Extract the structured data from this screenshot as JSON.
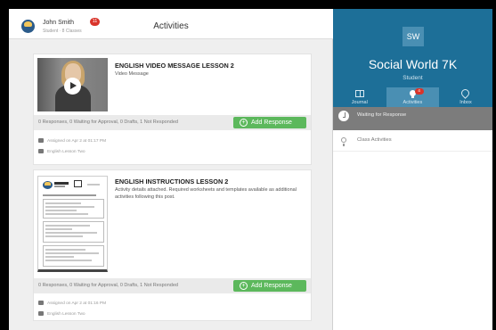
{
  "header": {
    "user_name": "John Smith",
    "user_sub": "Student · 8 Classes",
    "notification_count": "11",
    "page_title": "Activities"
  },
  "activities": [
    {
      "title": "ENGLISH VIDEO MESSAGE LESSON 2",
      "subtitle": "Video Message",
      "responses": "0 Responses, 0 Waiting for Approval, 0 Drafts, 1 Not Responded",
      "add_label": "Add Response",
      "assigned": "Assigned on Apr 2 at 01:17 PM",
      "folder": "English Lesson Two"
    },
    {
      "title": "ENGLISH INSTRUCTIONS LESSON 2",
      "subtitle": "Activity details attached. Required worksheets and templates available as additional activities following this post.",
      "responses": "0 Responses, 0 Waiting for Approval, 0 Drafts, 1 Not Responded",
      "add_label": "Add Response",
      "assigned": "Assigned on Apr 2 at 01:16 PM",
      "folder": "English Lesson Two"
    }
  ],
  "sidebar": {
    "initials": "SW",
    "class_name": "Social World 7K",
    "role": "Student",
    "tabs": [
      {
        "label": "Journal"
      },
      {
        "label": "Activities",
        "badge": "4"
      },
      {
        "label": "Inbox"
      }
    ],
    "waiting_label": "Waiting for Response",
    "class_activities_label": "Class Activities"
  },
  "colors": {
    "accent_blue": "#1d6f98",
    "add_green": "#5cb85c",
    "badge_red": "#d9342b"
  }
}
